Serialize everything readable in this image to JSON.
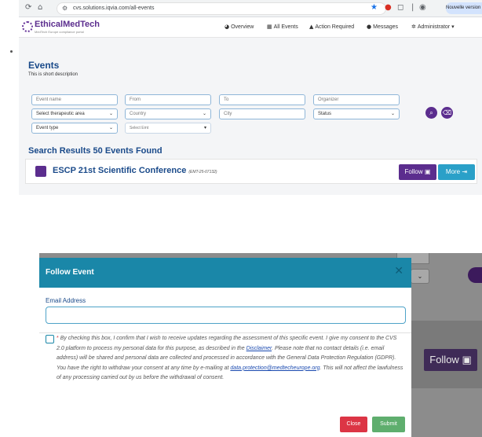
{
  "browser": {
    "url": "cvs.solutions.iqvia.com/all-events",
    "update_label": "Nouvelle version de Chrome"
  },
  "header": {
    "logo_text": "EthicalMedTech",
    "logo_sub": "MedTech Europe compliance portal",
    "nav": [
      {
        "label": "Overview",
        "icon": "dashboard-icon"
      },
      {
        "label": "All Events",
        "icon": "calendar-icon"
      },
      {
        "label": "Action Required",
        "icon": "warning-icon"
      },
      {
        "label": "Messages",
        "icon": "chat-icon"
      },
      {
        "label": "Administrator",
        "icon": "gear-icon"
      }
    ]
  },
  "page": {
    "title": "Events",
    "description": "This is short description"
  },
  "filters": {
    "event_name": "Event name",
    "from": "From",
    "to": "To",
    "organizer": "Organizer",
    "therapeutic_area": "Select therapeutic area",
    "country": "Country",
    "city": "City",
    "status": "Status",
    "event_type": "Event type",
    "select_emt": "Select Emt"
  },
  "results": {
    "title": "Search Results 50 Events Found",
    "event_name": "ESCP 21st Scientific Conference",
    "event_code": "(EMT-25-07132)",
    "follow_label": "Follow",
    "more_label": "More"
  },
  "modal": {
    "title": "Follow Event",
    "email_label": "Email Address",
    "email_value": "",
    "consent_required": "*",
    "consent_part1": "By checking this box, I confirm that I wish to receive updates regarding the assessment of this specific event. I give my consent to the CVS 2.0 platform to process my personal data for this purpose, as described in the ",
    "disclaimer_link": "Disclaimer",
    "consent_part2": ". Please note that no contact details (i.e. email address) will be shared and personal data are collected and processed in accordance with the General Data Protection Regulation (GDPR).",
    "consent_part3": "You have the right to withdraw your consent at any time by e-mailing at ",
    "email_link": "data.protection@medtecheurope.org",
    "consent_part4": ". This will not affect the lawfulness of any processing carried out by us before the withdrawal of consent.",
    "close_label": "Close",
    "submit_label": "Submit"
  },
  "background": {
    "follow_label": "Follow"
  },
  "colors": {
    "brand_purple": "#5b2d8e",
    "modal_teal": "#1a87a8",
    "title_blue": "#1a4a8a",
    "close_red": "#dc3545",
    "submit_green": "#5fae6e"
  }
}
